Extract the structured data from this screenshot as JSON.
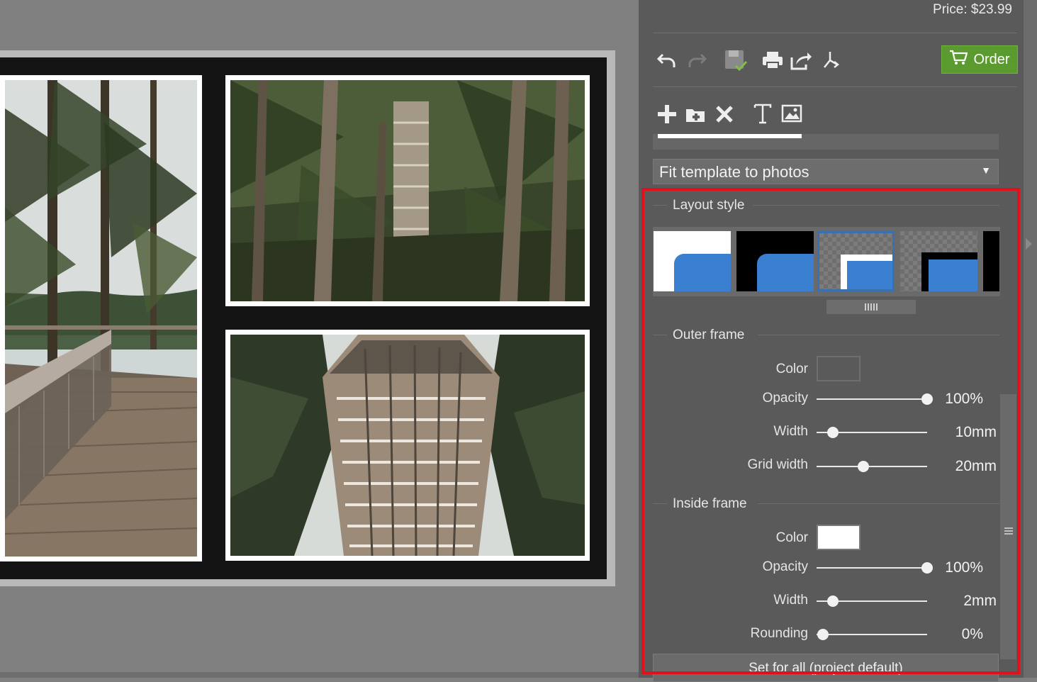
{
  "header": {
    "price": "Price: $23.99"
  },
  "toolbar": {
    "order_label": "Order",
    "icons": [
      "undo-icon",
      "redo-icon",
      "save-icon",
      "print-icon",
      "share-icon",
      "export-icon",
      "cart-icon"
    ]
  },
  "edit_tools": {
    "icons": [
      "add-icon",
      "add-folder-icon",
      "delete-icon",
      "text-icon",
      "image-icon"
    ]
  },
  "template_select": {
    "value": "Fit template to photos"
  },
  "layout_style": {
    "title": "Layout style",
    "styles": [
      "white-frame",
      "black-frame",
      "transparent-white-inner",
      "transparent-black-inner",
      "black-edge"
    ],
    "selected_index": 2
  },
  "outer_frame": {
    "title": "Outer frame",
    "color_label": "Color",
    "color": "#5a5a5a",
    "opacity_label": "Opacity",
    "opacity_value": "100%",
    "opacity_level": 1.0,
    "width_label": "Width",
    "width_value": "10mm",
    "width_level": 0.15,
    "grid_width_label": "Grid width",
    "grid_width_value": "20mm",
    "grid_width_level": 0.42
  },
  "inside_frame": {
    "title": "Inside frame",
    "color_label": "Color",
    "color": "#ffffff",
    "opacity_label": "Opacity",
    "opacity_value": "100%",
    "opacity_level": 1.0,
    "width_label": "Width",
    "width_value": "2mm",
    "width_level": 0.15,
    "rounding_label": "Rounding",
    "rounding_value": "0%",
    "rounding_level": 0.06
  },
  "footer": {
    "set_default_label": "Set for all (project default)"
  },
  "colors": {
    "accent_green": "#5b9a2f",
    "highlight_red": "#e3101c",
    "selection_blue": "#3a7fd0"
  }
}
